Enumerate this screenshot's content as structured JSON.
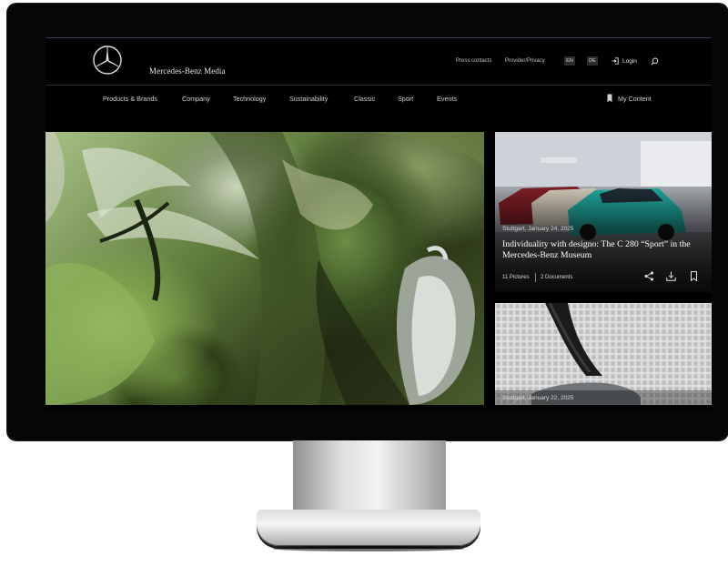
{
  "header": {
    "brand": "Mercedes-Benz Media",
    "press_contacts": "Press contacts",
    "provider_privacy": "Provider/Privacy",
    "lang_en": "EN",
    "lang_de": "DE",
    "login": "Login"
  },
  "nav": {
    "items": [
      "Products & Brands",
      "Company",
      "Technology",
      "Sustainability",
      "Classic",
      "Sport",
      "Events"
    ],
    "my_content": "My Content"
  },
  "cards": [
    {
      "date": "Stuttgart, January 24, 2025",
      "title": "Individuality with designo: The C 280 “Sport” in the Mercedes-Benz Museum",
      "pictures": "11 Pictures",
      "documents": "2 Documents"
    },
    {
      "date": "Stuttgart, January 22, 2025"
    }
  ],
  "icons": {
    "logo": "mercedes-star-icon",
    "login": "login-icon",
    "search": "search-icon",
    "my_content": "bookmark-icon",
    "share": "share-icon",
    "download": "download-icon",
    "bookmark": "bookmark-icon"
  }
}
